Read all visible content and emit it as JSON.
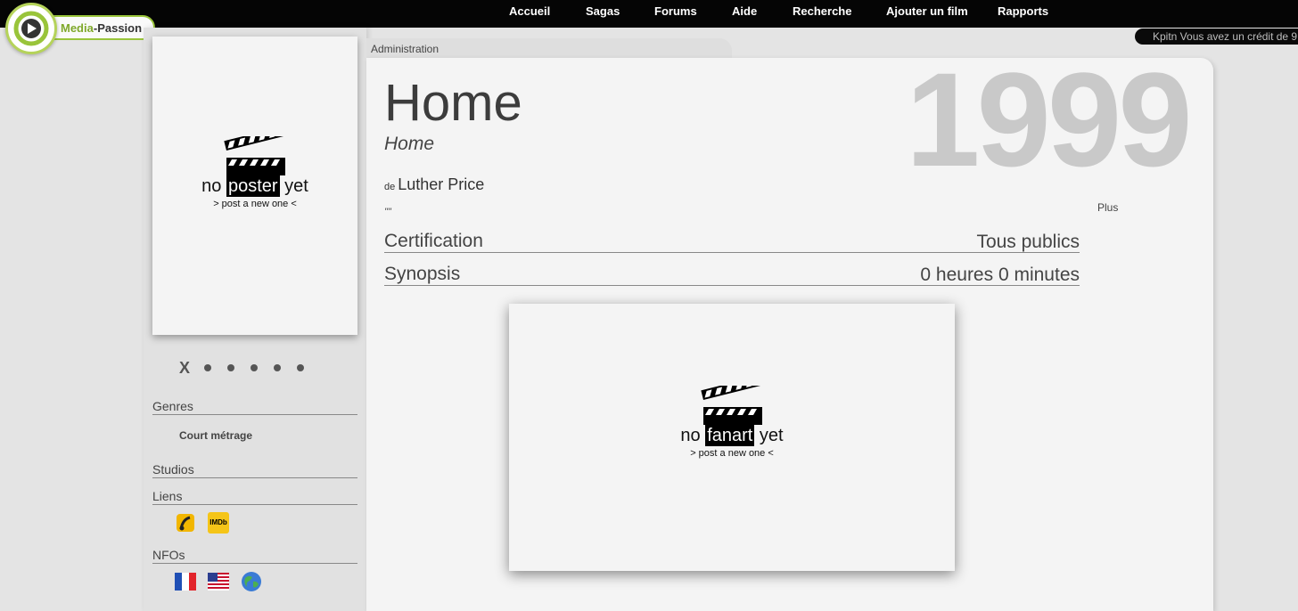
{
  "nav": {
    "items": [
      "Accueil",
      "Sagas",
      "Forums",
      "Aide",
      "Recherche",
      "Ajouter un film",
      "Rapports"
    ]
  },
  "ticker": {
    "text": "Kpitn  Vous avez un crédit de 9"
  },
  "logo": {
    "prefix": "Media",
    "dash": "-",
    "suffix": "Passion",
    "accent_color": "#99c43a"
  },
  "poster": {
    "no": "no",
    "word": "poster",
    "yet": "yet",
    "post_link": "> post a new one <"
  },
  "rating": {
    "clear": "X",
    "dot_count": 5
  },
  "sidebar": {
    "genres_title": "Genres",
    "genre": "Court métrage",
    "studios_title": "Studios",
    "links_title": "Liens",
    "nfos_title": "NFOs",
    "imdb": "IMDb"
  },
  "admin": {
    "label": "Administration"
  },
  "movie": {
    "year": "1999",
    "title": "Home",
    "original_title": "Home",
    "by": "de",
    "director": "Luther Price",
    "tagline": "\"\"",
    "more": "Plus",
    "certification_label": "Certification",
    "certification_value": "Tous publics",
    "synopsis_label": "Synopsis",
    "duration": "0 heures 0 minutes"
  },
  "fanart": {
    "no": "no",
    "word": "fanart",
    "yet": "yet",
    "post_link": "> post a new one <"
  }
}
